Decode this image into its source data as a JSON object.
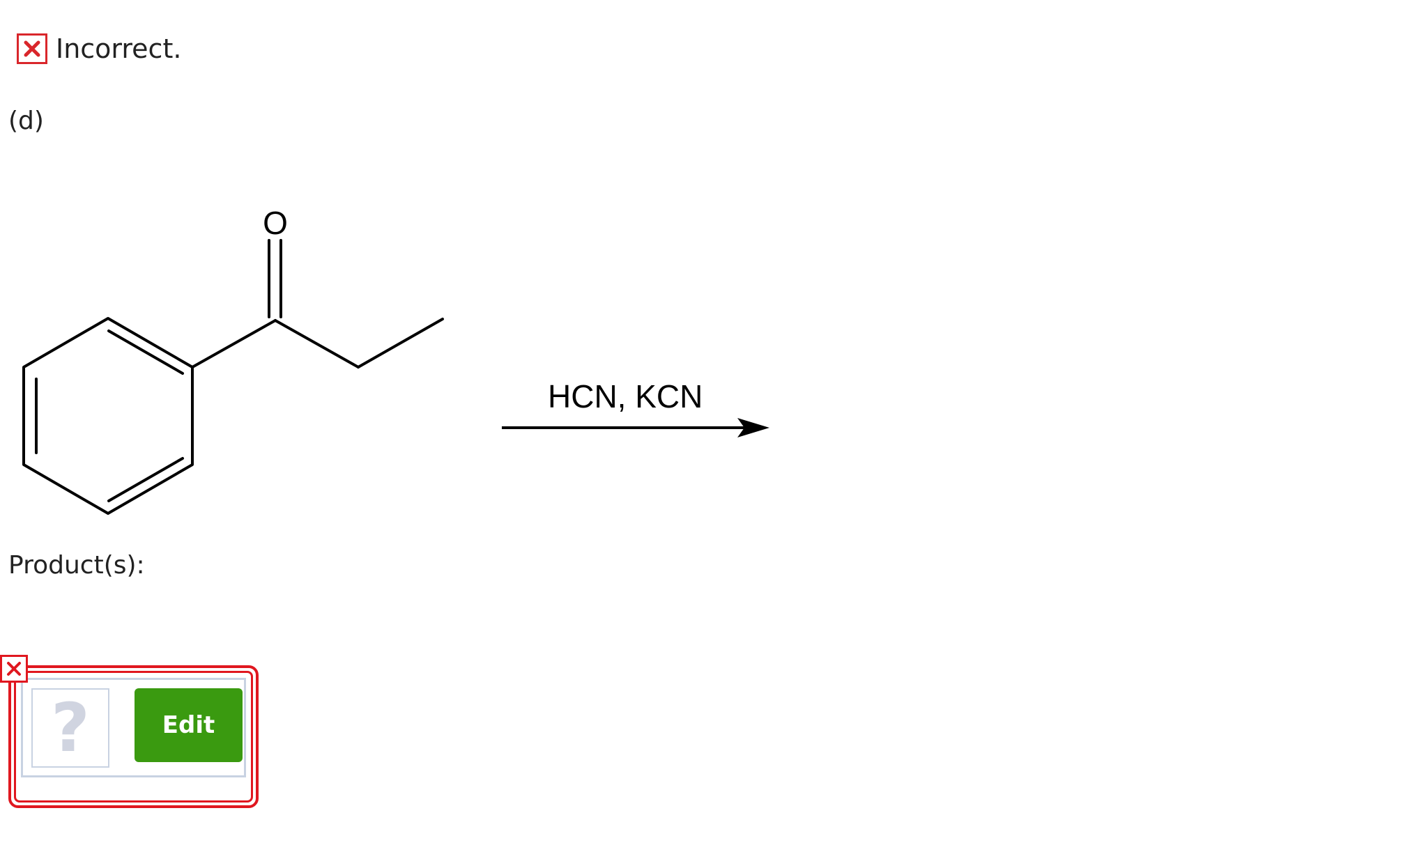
{
  "feedback": {
    "status_icon": "incorrect-x-icon",
    "status_text": "Incorrect.",
    "status_color": "#d9262b"
  },
  "question": {
    "part_label": "(d)",
    "reactant": {
      "name": "1-phenylpropan-1-one",
      "atom_labels": [
        "O"
      ]
    },
    "reagent_label": "HCN, KCN",
    "products_label": "Product(s):"
  },
  "answer": {
    "placeholder_symbol": "?",
    "edit_label": "Edit",
    "edit_color": "#3a9a10",
    "error_icon": "error-x-icon",
    "error_color": "#e0171f"
  }
}
